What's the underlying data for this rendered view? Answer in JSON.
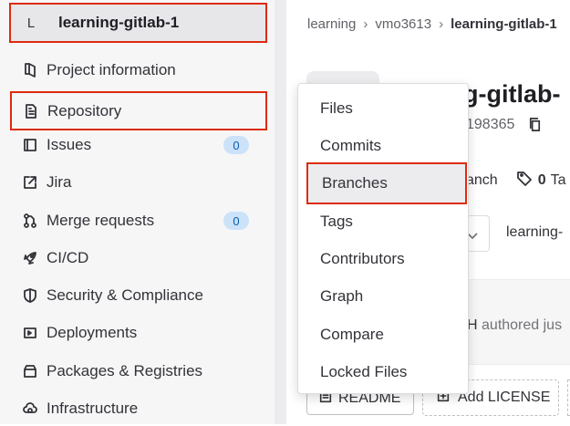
{
  "colors": {
    "accent_outline": "#dd2b0e",
    "badge_bg": "#cbe2f9",
    "badge_text": "#0b5cad",
    "sidebar_bg": "#f6f6f7"
  },
  "project": {
    "avatar_letter": "L",
    "name": "learning-gitlab-1"
  },
  "sidebar": {
    "items": [
      {
        "label": "Project information",
        "icon": "project-icon"
      },
      {
        "label": "Repository",
        "icon": "document-icon"
      },
      {
        "label": "Issues",
        "icon": "issues-icon",
        "badge": "0"
      },
      {
        "label": "Jira",
        "icon": "external-link-icon"
      },
      {
        "label": "Merge requests",
        "icon": "merge-request-icon",
        "badge": "0"
      },
      {
        "label": "CI/CD",
        "icon": "rocket-icon"
      },
      {
        "label": "Security & Compliance",
        "icon": "shield-icon"
      },
      {
        "label": "Deployments",
        "icon": "deployments-icon"
      },
      {
        "label": "Packages & Registries",
        "icon": "package-icon"
      },
      {
        "label": "Infrastructure",
        "icon": "cloud-gear-icon"
      }
    ]
  },
  "breadcrumb": {
    "items": [
      "learning",
      "vmo3613",
      "learning-gitlab-1"
    ]
  },
  "main": {
    "title_fragment": "g-gitlab-",
    "project_id_fragment": "198365",
    "stats_branch_fragment": "anch",
    "stats_tags_count": "0",
    "stats_tags_fragment": "Ta",
    "path_fragment": "learning-",
    "commit_mark": ":",
    "commit_author_fragment": "H",
    "commit_authored_fragment": "authored jus",
    "readme_button": "README",
    "license_button": "Add LICENSE"
  },
  "repository_menu": {
    "items": [
      "Files",
      "Commits",
      "Branches",
      "Tags",
      "Contributors",
      "Graph",
      "Compare",
      "Locked Files"
    ],
    "active_index": 2
  }
}
